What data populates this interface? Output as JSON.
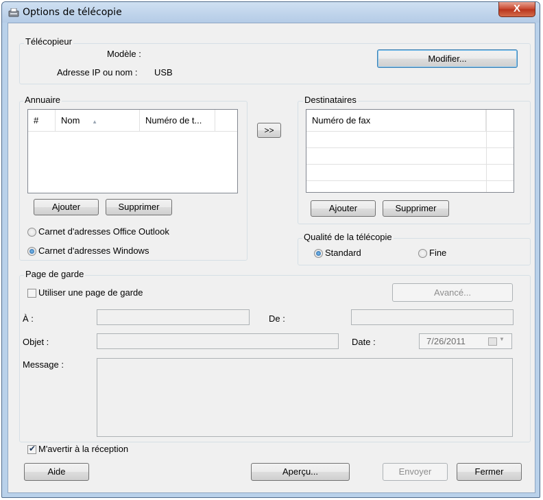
{
  "window": {
    "title": "Options de télécopie",
    "close_glyph": "X"
  },
  "telecopieur": {
    "legend": "Télécopieur",
    "model_label": "Modèle :",
    "model_value": "",
    "address_label": "Adresse IP ou nom :",
    "address_value": "USB",
    "modify_button": "Modifier..."
  },
  "annuaire": {
    "legend": "Annuaire",
    "columns": [
      "#",
      "Nom",
      "Numéro de t..."
    ],
    "sort_glyph": "▲",
    "add_button": "Ajouter",
    "delete_button": "Supprimer",
    "radio_outlook": "Carnet d'adresses Office Outlook",
    "radio_windows": "Carnet d'adresses Windows",
    "selected_source": "Carnet d'adresses Windows"
  },
  "transfer_button": ">>",
  "destinataires": {
    "legend": "Destinataires",
    "columns": [
      "Numéro de fax"
    ],
    "add_button": "Ajouter",
    "delete_button": "Supprimer"
  },
  "qualite": {
    "legend": "Qualité de la télécopie",
    "standard_label": "Standard",
    "fine_label": "Fine",
    "selected": "Standard"
  },
  "page_de_garde": {
    "legend": "Page de garde",
    "use_checkbox_label": "Utiliser une page de garde",
    "use_checked": false,
    "advanced_button": "Avancé...",
    "to_label": "À :",
    "to_value": "",
    "from_label": "De :",
    "from_value": "",
    "subject_label": "Objet :",
    "subject_value": "",
    "date_label": "Date :",
    "date_value": "7/26/2011",
    "message_label": "Message :",
    "message_value": ""
  },
  "notify": {
    "label": "M'avertir à la réception",
    "checked": true
  },
  "footer": {
    "help_button": "Aide",
    "preview_button": "Aperçu...",
    "send_button": "Envoyer",
    "close_button": "Fermer"
  },
  "colors": {
    "title_bar": "#c4d8ee",
    "close_button": "#c7452c",
    "dialog_bg": "#f0f0f0"
  }
}
